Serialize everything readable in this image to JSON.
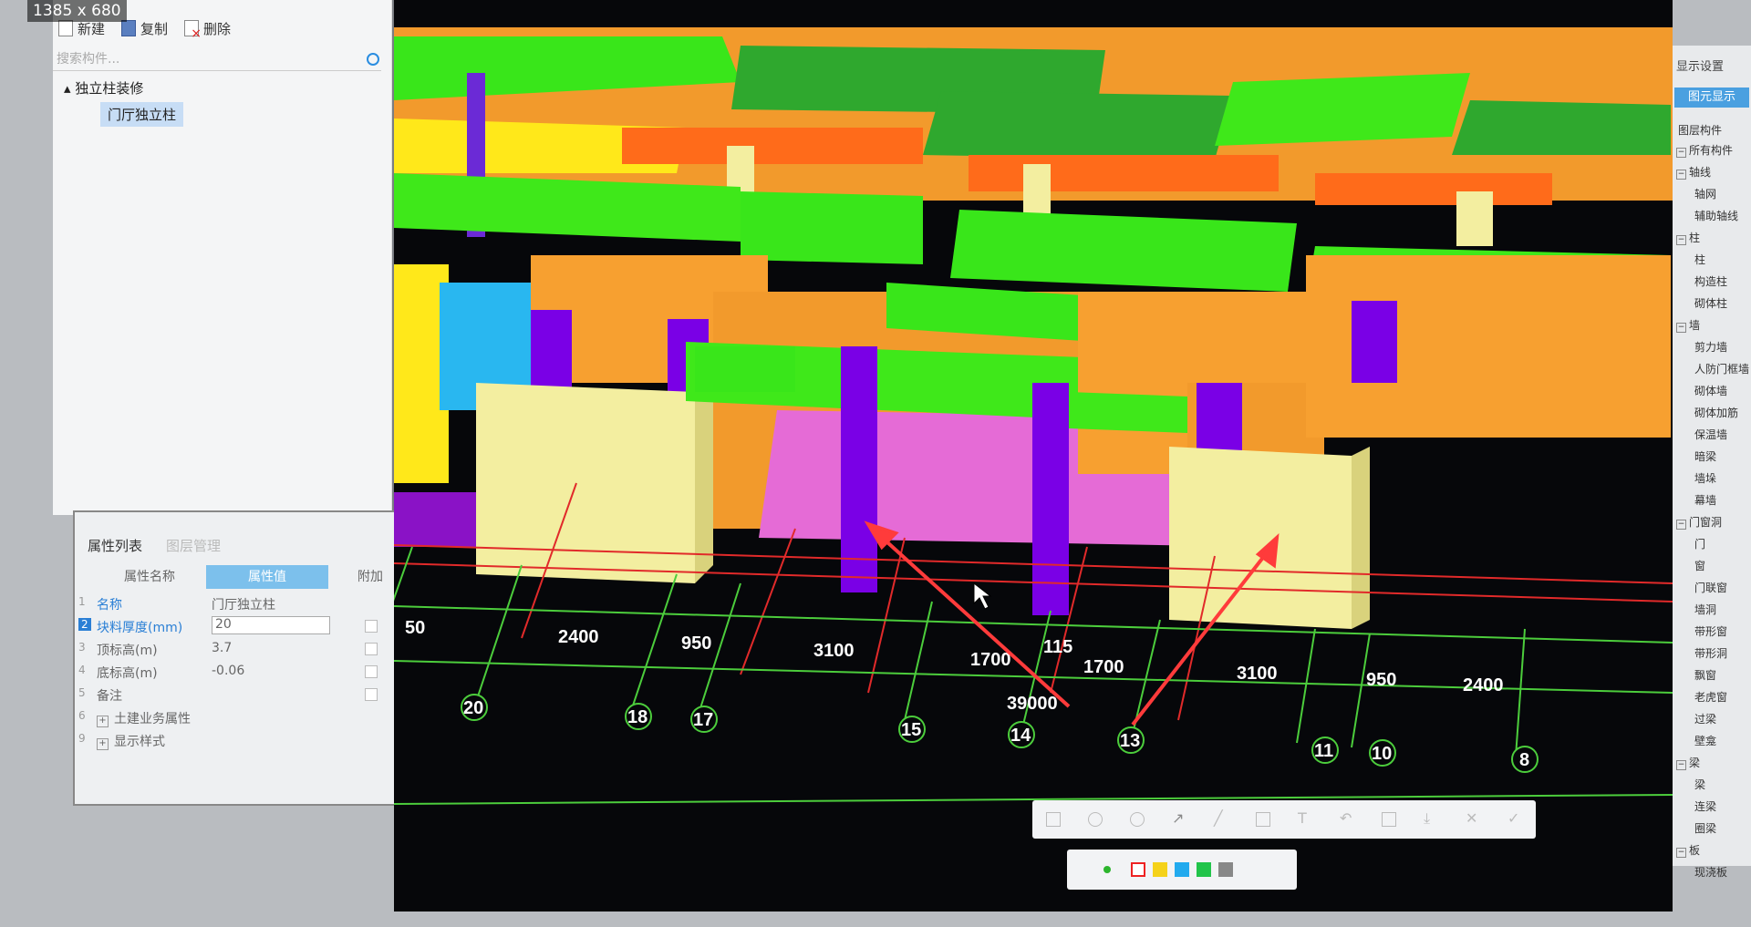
{
  "overlay": {
    "size_label": "1385 x 680"
  },
  "toolbar": {
    "new_label": "新建",
    "copy_label": "复制",
    "delete_label": "删除"
  },
  "search": {
    "placeholder": "搜索构件..."
  },
  "tree": {
    "parent": "独立柱装修",
    "child": "门厅独立柱"
  },
  "props": {
    "tab_active": "属性列表",
    "tab_inactive": "图层管理",
    "headers": {
      "name": "属性名称",
      "value": "属性值",
      "extra": "附加"
    },
    "rows": [
      {
        "num": "1",
        "name": "名称",
        "value": "门厅独立柱"
      },
      {
        "num": "2",
        "name": "块料厚度(mm)",
        "value": "20"
      },
      {
        "num": "3",
        "name": "顶标高(m)",
        "value": "3.7"
      },
      {
        "num": "4",
        "name": "底标高(m)",
        "value": "-0.06"
      },
      {
        "num": "5",
        "name": "备注",
        "value": ""
      },
      {
        "num": "6",
        "name": "土建业务属性",
        "value": ""
      },
      {
        "num": "9",
        "name": "显示样式",
        "value": ""
      }
    ]
  },
  "viewport": {
    "dimensions": [
      "50",
      "2400",
      "950",
      "3100",
      "1700",
      "115",
      "1700",
      "3100",
      "950",
      "2400"
    ],
    "total": "39000",
    "axes": [
      "20",
      "18",
      "17",
      "15",
      "14",
      "13",
      "11",
      "10",
      "8"
    ]
  },
  "display_settings": {
    "title": "显示设置",
    "tab": "图元显示",
    "tab2": "图层构件",
    "items": [
      {
        "label": "所有构件",
        "box": "−"
      },
      {
        "label": "轴线",
        "box": "−"
      },
      {
        "label": "轴网",
        "box": ""
      },
      {
        "label": "辅助轴线",
        "box": ""
      },
      {
        "label": "柱",
        "box": "−"
      },
      {
        "label": "柱",
        "box": ""
      },
      {
        "label": "构造柱",
        "box": ""
      },
      {
        "label": "砌体柱",
        "box": ""
      },
      {
        "label": "墙",
        "box": "−"
      },
      {
        "label": "剪力墙",
        "box": ""
      },
      {
        "label": "人防门框墙",
        "box": ""
      },
      {
        "label": "砌体墙",
        "box": ""
      },
      {
        "label": "砌体加筋",
        "box": ""
      },
      {
        "label": "保温墙",
        "box": ""
      },
      {
        "label": "暗梁",
        "box": ""
      },
      {
        "label": "墙垛",
        "box": ""
      },
      {
        "label": "幕墙",
        "box": ""
      },
      {
        "label": "门窗洞",
        "box": "−"
      },
      {
        "label": "门",
        "box": ""
      },
      {
        "label": "窗",
        "box": ""
      },
      {
        "label": "门联窗",
        "box": ""
      },
      {
        "label": "墙洞",
        "box": ""
      },
      {
        "label": "带形窗",
        "box": ""
      },
      {
        "label": "带形洞",
        "box": ""
      },
      {
        "label": "飘窗",
        "box": ""
      },
      {
        "label": "老虎窗",
        "box": ""
      },
      {
        "label": "过梁",
        "box": ""
      },
      {
        "label": "壁龛",
        "box": ""
      },
      {
        "label": "梁",
        "box": "−"
      },
      {
        "label": "梁",
        "box": ""
      },
      {
        "label": "连梁",
        "box": ""
      },
      {
        "label": "圈梁",
        "box": ""
      },
      {
        "label": "板",
        "box": "−"
      },
      {
        "label": "现浇板",
        "box": ""
      }
    ]
  },
  "colors": {
    "green_slab": "#3fe81a",
    "purple_column": "#7a00e6",
    "orange_wall": "#f7a030",
    "pink_floor": "#e56bd6",
    "cream_box": "#f3eea0",
    "axis_red": "#e12a2a",
    "axis_green": "#4ccd3c"
  }
}
